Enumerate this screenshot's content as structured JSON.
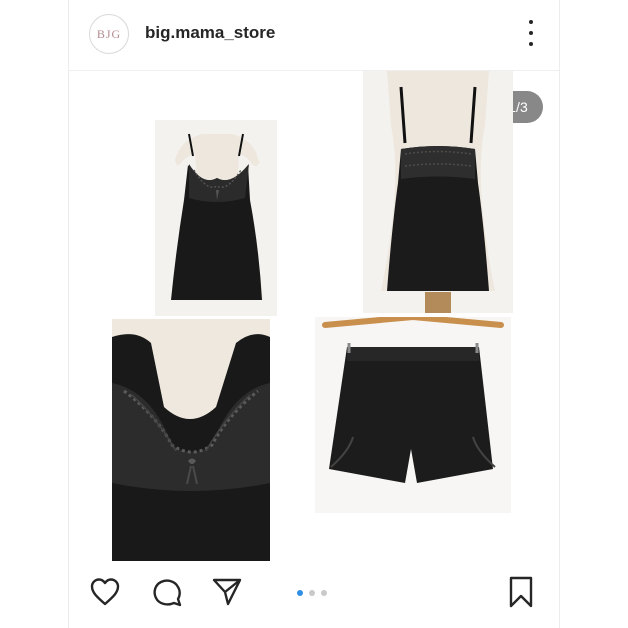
{
  "post": {
    "username": "big.mama_store",
    "avatar_text": "BJG",
    "counter": "1/3"
  },
  "colors": {
    "accent": "#2f8fe5",
    "text": "#262626",
    "counter_bg": "#5a5a5a"
  },
  "icons": {
    "like": "heart-icon",
    "comment": "comment-icon",
    "share": "share-icon",
    "save": "bookmark-icon",
    "more": "more-options-icon"
  },
  "carousel": {
    "total_pages": 3,
    "active_page": 1
  }
}
